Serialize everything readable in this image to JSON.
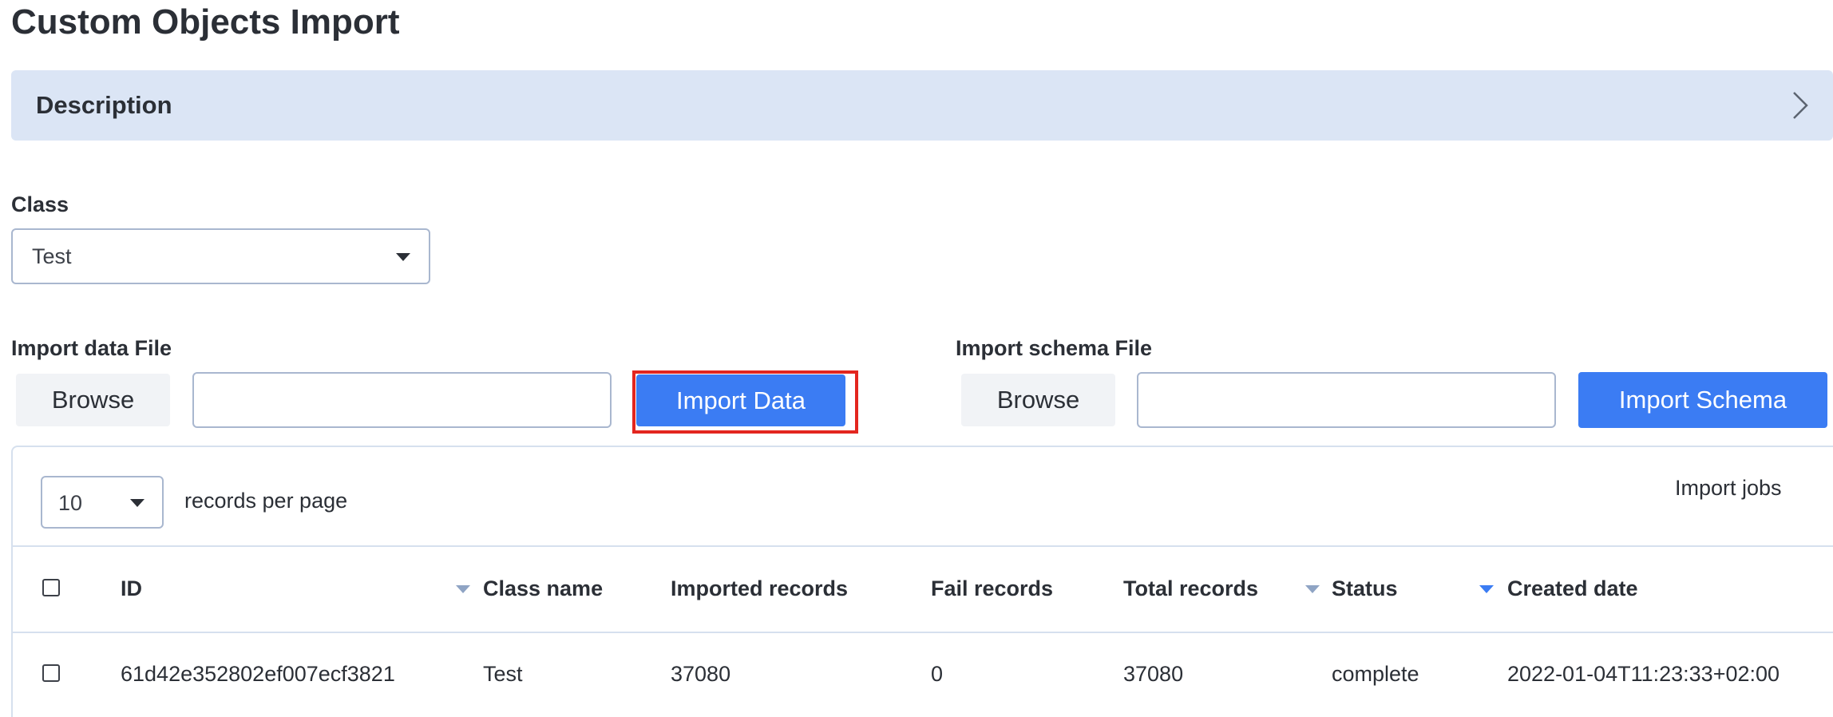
{
  "page": {
    "title": "Custom Objects Import"
  },
  "description": {
    "label": "Description"
  },
  "class_select": {
    "label": "Class",
    "value": "Test"
  },
  "import_data": {
    "label": "Import data File",
    "browse_label": "Browse",
    "file_value": "",
    "button_label": "Import Data"
  },
  "import_schema": {
    "label": "Import schema File",
    "browse_label": "Browse",
    "file_value": "",
    "button_label": "Import Schema"
  },
  "jobs": {
    "per_page_value": "10",
    "per_page_label": "records per page",
    "title": "Import jobs",
    "columns": {
      "id": "ID",
      "class_name": "Class name",
      "imported": "Imported records",
      "fail": "Fail records",
      "total": "Total records",
      "status": "Status",
      "created": "Created date"
    },
    "rows": [
      {
        "id": "61d42e352802ef007ecf3821",
        "class_name": "Test",
        "imported": "37080",
        "fail": "0",
        "total": "37080",
        "status": "complete",
        "created": "2022-01-04T11:23:33+02:00"
      }
    ]
  },
  "colors": {
    "accent": "#3b7cf3",
    "description_bg": "#dbe5f5",
    "highlight": "#e3261f",
    "border": "#a9b7cf"
  },
  "icons": {
    "chevron": "chevron-right-icon",
    "caret": "caret-down-icon",
    "sort": "sort-down-icon"
  }
}
